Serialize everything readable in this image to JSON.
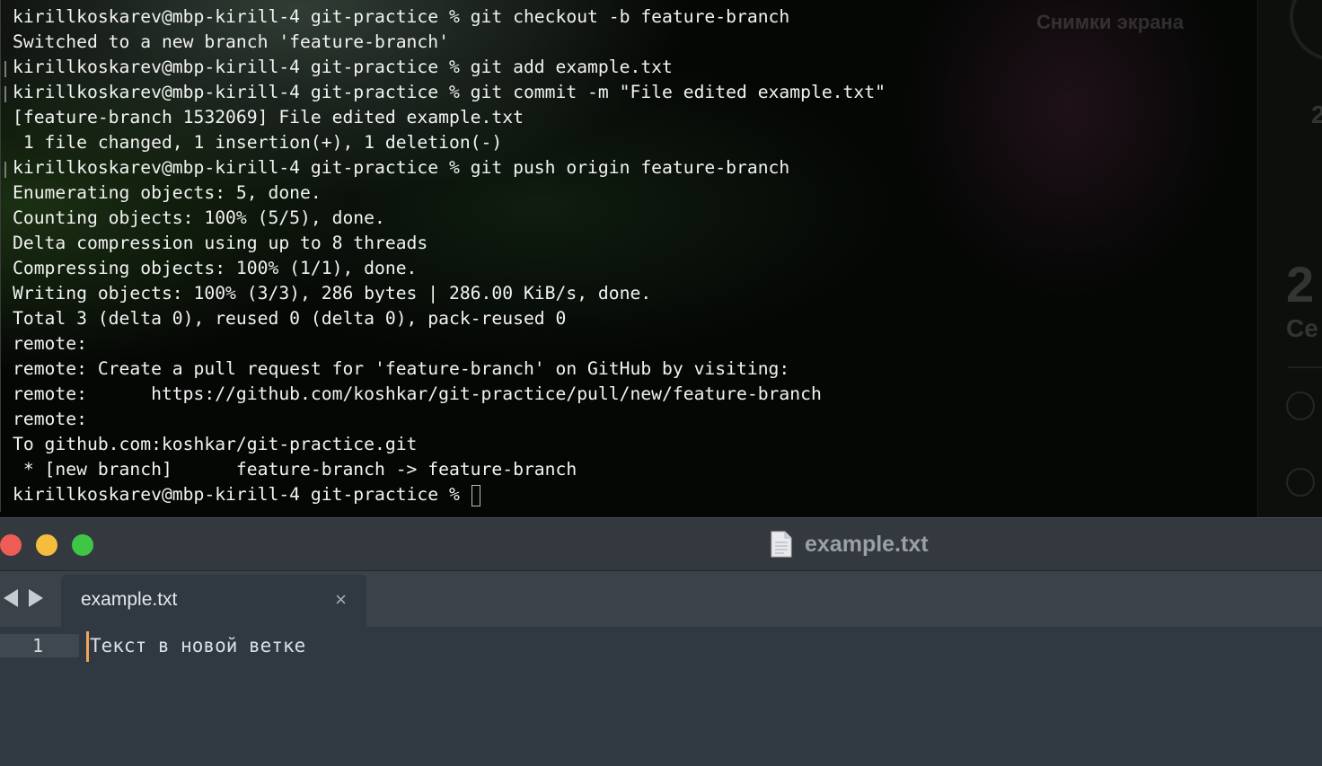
{
  "terminal": {
    "lines": [
      "kirillkoskarev@mbp-kirill-4 git-practice % git checkout -b feature-branch",
      "Switched to a new branch 'feature-branch'",
      "kirillkoskarev@mbp-kirill-4 git-practice % git add example.txt",
      "kirillkoskarev@mbp-kirill-4 git-practice % git commit -m \"File edited example.txt\"",
      "[feature-branch 1532069] File edited example.txt",
      " 1 file changed, 1 insertion(+), 1 deletion(-)",
      "kirillkoskarev@mbp-kirill-4 git-practice % git push origin feature-branch",
      "Enumerating objects: 5, done.",
      "Counting objects: 100% (5/5), done.",
      "Delta compression using up to 8 threads",
      "Compressing objects: 100% (1/1), done.",
      "Writing objects: 100% (3/3), 286 bytes | 286.00 KiB/s, done.",
      "Total 3 (delta 0), reused 0 (delta 0), pack-reused 0",
      "remote:",
      "remote: Create a pull request for 'feature-branch' on GitHub by visiting:",
      "remote:      https://github.com/koshkar/git-practice/pull/new/feature-branch",
      "remote:",
      "To github.com:koshkar/git-practice.git",
      " * [new branch]      feature-branch -> feature-branch"
    ],
    "prompt": "kirillkoskarev@mbp-kirill-4 git-practice % "
  },
  "desktop": {
    "screenshots_label": "Снимки экрана",
    "peek_top": "2",
    "peek_big": "2",
    "peek_small": "Се"
  },
  "editor": {
    "window_title": "example.txt",
    "tab_label": "example.txt",
    "tab_close_glyph": "×",
    "line_number": "1",
    "line_text": "Текст в новой ветке",
    "caret_color": "#f0a45d"
  }
}
